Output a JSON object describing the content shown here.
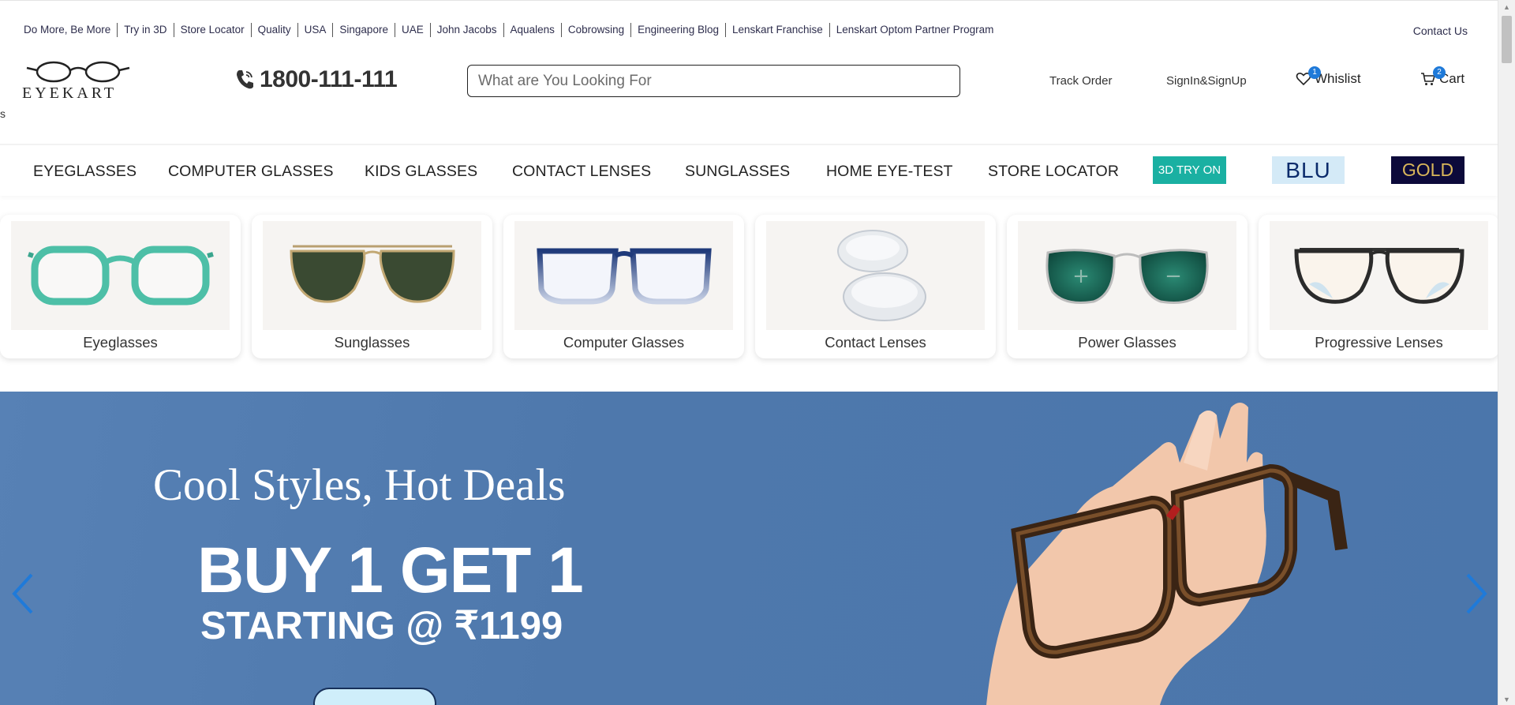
{
  "topbar": {
    "links": [
      "Do More, Be More",
      "Try in 3D",
      "Store Locator",
      "Quality",
      "USA",
      "Singapore",
      "UAE",
      "John Jacobs",
      "Aqualens",
      "Cobrowsing",
      "Engineering Blog",
      "Lenskart Franchise",
      "Lenskart Optom Partner Program"
    ],
    "contact": "Contact Us"
  },
  "header": {
    "logo": "EYEKART",
    "stray_text": "s",
    "phone": "1800-111-111",
    "search_placeholder": "What are You Looking For",
    "track_order": "Track Order",
    "signin": "SignIn&SignUp",
    "wishlist": {
      "label": "Whislist",
      "count": "1"
    },
    "cart": {
      "label": "Cart",
      "count": "2"
    }
  },
  "nav": {
    "items": [
      "EYEGLASSES",
      "COMPUTER GLASSES",
      "KIDS GLASSES",
      "CONTACT LENSES",
      "SUNGLASSES",
      "HOME EYE-TEST",
      "STORE LOCATOR"
    ],
    "try3d": "3D TRY ON",
    "blu": "BLU",
    "gold": "GOLD"
  },
  "categories": [
    "Eyeglasses",
    "Sunglasses",
    "Computer Glasses",
    "Contact Lenses",
    "Power Glasses",
    "Progressive Lenses"
  ],
  "banner": {
    "subtitle": "Cool Styles, Hot Deals",
    "headline": "BUY 1 GET 1",
    "offer": "STARTING @ ₹1199"
  },
  "colors": {
    "accent": "#1f7ad9",
    "banner_bg": "#4e78ac",
    "try3d_bg": "#1ab0a2",
    "gold_bg": "#0c0a3a"
  }
}
